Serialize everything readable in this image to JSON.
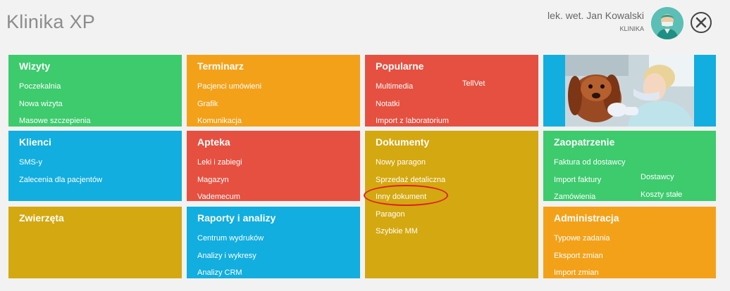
{
  "header": {
    "app_title": "Klinika XP",
    "user_name": "lek. wet. Jan Kowalski",
    "user_org": "KLINIKA"
  },
  "tiles": {
    "wizyty": {
      "title": "Wizyty",
      "items": [
        "Poczekalnia",
        "Nowa wizyta",
        "Masowe szczepienia"
      ]
    },
    "terminarz": {
      "title": "Terminarz",
      "items": [
        "Pacjenci umówieni",
        "Grafik",
        "Komunikacja"
      ]
    },
    "popularne": {
      "title": "Popularne",
      "items": [
        "Multimedia",
        "Notatki",
        "Import z laboratorium"
      ],
      "items_col2": [
        "TellVet"
      ]
    },
    "klienci": {
      "title": "Klienci",
      "items": [
        "SMS-y",
        "Zalecenia dla pacjentów"
      ]
    },
    "apteka": {
      "title": "Apteka",
      "items": [
        "Leki i zabiegi",
        "Magazyn",
        "Vademecum"
      ]
    },
    "dokumenty": {
      "title": "Dokumenty",
      "items": [
        "Nowy paragon",
        "Sprzedaż detaliczna",
        "Inny dokument",
        "Paragon",
        "Szybkie MM"
      ]
    },
    "zaopatrzenie": {
      "title": "Zaopatrzenie",
      "items": [
        "Faktura od dostawcy",
        "Import faktury",
        "Zamówienia"
      ],
      "items_col2": [
        "Dostawcy",
        "Koszty stałe"
      ]
    },
    "zwierzeta": {
      "title": "Zwierzęta"
    },
    "raporty": {
      "title": "Raporty i analizy",
      "items": [
        "Centrum wydruków",
        "Analizy i wykresy",
        "Analizy CRM"
      ]
    },
    "administracja": {
      "title": "Administracja",
      "items": [
        "Typowe zadania",
        "Eksport zmian",
        "Import zmian"
      ]
    }
  },
  "colors": {
    "green": "#3dcb6d",
    "orange": "#f4a11a",
    "red": "#e65040",
    "blue": "#12aedf",
    "mustard": "#d4a810",
    "highlight": "#e02020"
  }
}
